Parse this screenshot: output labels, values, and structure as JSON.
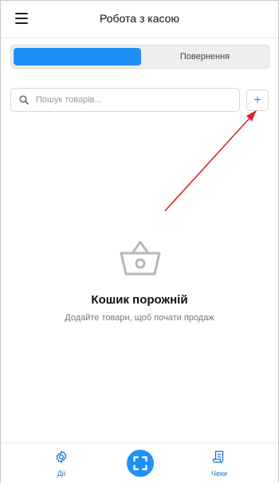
{
  "header": {
    "title": "Робота з касою",
    "menu_icon": "hamburger-menu-icon"
  },
  "tabs": [
    {
      "label": "",
      "active": true
    },
    {
      "label": "Повернення",
      "active": false
    }
  ],
  "search": {
    "placeholder": "Пошук товарів...",
    "value": "",
    "icon": "search-icon"
  },
  "add_button": {
    "label": "+",
    "icon": "plus-icon"
  },
  "empty_state": {
    "icon": "basket-icon",
    "title": "Кошик порожній",
    "subtitle": "Додайте товари, щоб почати продаж"
  },
  "bottom_nav": {
    "actions_label": "Дії",
    "actions_icon": "gear-icon",
    "scan_icon": "scan-icon",
    "receipts_label": "Чеки",
    "receipts_icon": "receipt-icon"
  },
  "colors": {
    "accent": "#1e90f7",
    "annotation_arrow": "#d9252a"
  }
}
